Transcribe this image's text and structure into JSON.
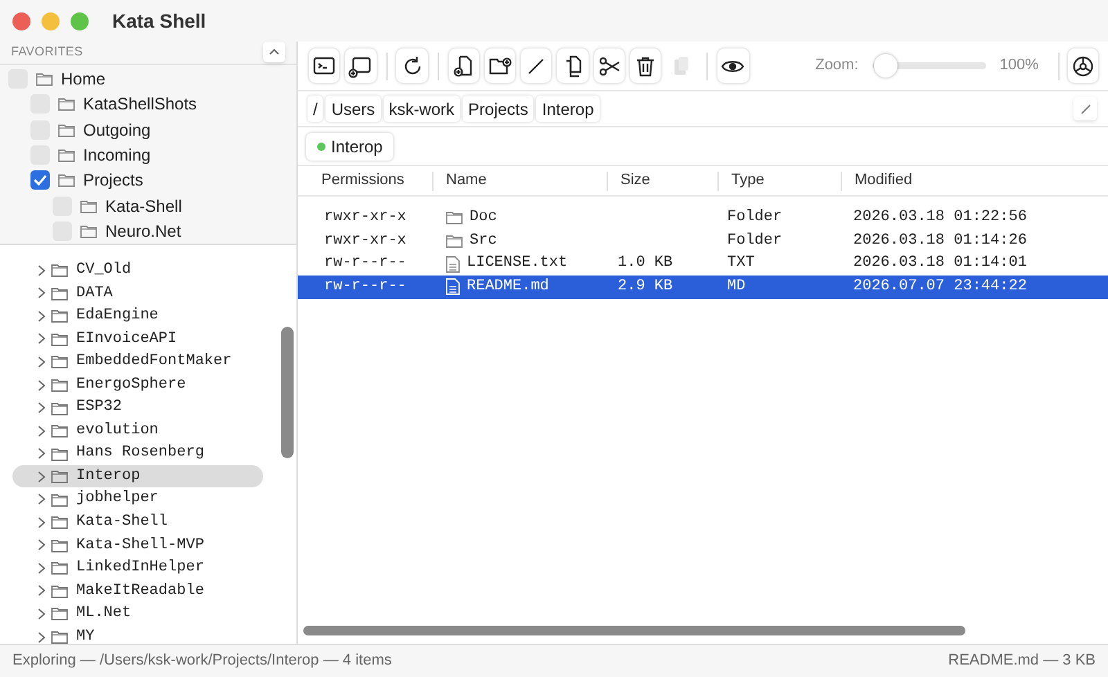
{
  "window": {
    "title": "Kata Shell"
  },
  "favorites": {
    "title": "FAVORITES",
    "items": [
      {
        "label": "Home",
        "checked": false,
        "children": [
          {
            "label": "KataShellShots",
            "checked": false
          },
          {
            "label": "Outgoing",
            "checked": false
          },
          {
            "label": "Incoming",
            "checked": false
          },
          {
            "label": "Projects",
            "checked": true,
            "children": [
              {
                "label": "Kata-Shell",
                "checked": false
              },
              {
                "label": "Neuro.Net",
                "checked": false
              }
            ]
          }
        ]
      }
    ]
  },
  "tree": [
    {
      "label": "CV_Old",
      "selected": false
    },
    {
      "label": "DATA",
      "selected": false
    },
    {
      "label": "EdaEngine",
      "selected": false
    },
    {
      "label": "EInvoiceAPI",
      "selected": false
    },
    {
      "label": "EmbeddedFontMaker",
      "selected": false
    },
    {
      "label": "EnergoSphere",
      "selected": false
    },
    {
      "label": "ESP32",
      "selected": false
    },
    {
      "label": "evolution",
      "selected": false
    },
    {
      "label": "Hans Rosenberg",
      "selected": false
    },
    {
      "label": "Interop",
      "selected": true
    },
    {
      "label": "jobhelper",
      "selected": false
    },
    {
      "label": "Kata-Shell",
      "selected": false
    },
    {
      "label": "Kata-Shell-MVP",
      "selected": false
    },
    {
      "label": "LinkedInHelper",
      "selected": false
    },
    {
      "label": "MakeItReadable",
      "selected": false
    },
    {
      "label": "ML.Net",
      "selected": false
    },
    {
      "label": "MY",
      "selected": false
    }
  ],
  "toolbar": {
    "buttons": [
      {
        "kind": "terminal",
        "disabled": false
      },
      {
        "kind": "new-terminal",
        "disabled": false
      },
      {
        "kind": "separator"
      },
      {
        "kind": "refresh",
        "disabled": false
      },
      {
        "kind": "separator"
      },
      {
        "kind": "new-file",
        "disabled": false
      },
      {
        "kind": "new-folder",
        "disabled": false
      },
      {
        "kind": "rename",
        "disabled": false
      },
      {
        "kind": "copy",
        "disabled": false
      },
      {
        "kind": "cut",
        "disabled": false
      },
      {
        "kind": "delete",
        "disabled": false
      },
      {
        "kind": "paste",
        "disabled": true
      },
      {
        "kind": "separator"
      },
      {
        "kind": "preview",
        "disabled": false
      }
    ],
    "zoom": {
      "label": "Zoom:",
      "level": 0,
      "reading": "100%"
    }
  },
  "breadcrumb": [
    "/",
    "Users",
    "ksk-work",
    "Projects",
    "Interop"
  ],
  "tabs": [
    {
      "label": "Interop",
      "selected": true,
      "color": "#5ac85a"
    }
  ],
  "table": {
    "columns": [
      "Permissions",
      "Name",
      "Size",
      "Type",
      "Modified"
    ],
    "rows": [
      {
        "kind": "folder",
        "permissions": "rwxr-xr-x",
        "name": "Doc",
        "type": "Folder",
        "modified": "2026.03.18 01:22:56",
        "selected": false
      },
      {
        "kind": "folder",
        "permissions": "rwxr-xr-x",
        "name": "Src",
        "type": "Folder",
        "modified": "2026.03.18 01:14:26",
        "selected": false
      },
      {
        "kind": "file",
        "permissions": "rw-r--r--",
        "name": "LICENSE.txt",
        "size": "1.0 KB",
        "type": "TXT",
        "modified": "2026.03.18 01:14:01",
        "selected": false
      },
      {
        "kind": "file",
        "permissions": "rw-r--r--",
        "name": "README.md",
        "size": "2.9 KB",
        "type": "MD",
        "modified": "2026.07.07 23:44:22",
        "selected": true
      }
    ]
  },
  "status_bar": {
    "left": "Exploring — /Users/ksk-work/Projects/Interop — 4 items",
    "right": "README.md — 3 KB"
  }
}
